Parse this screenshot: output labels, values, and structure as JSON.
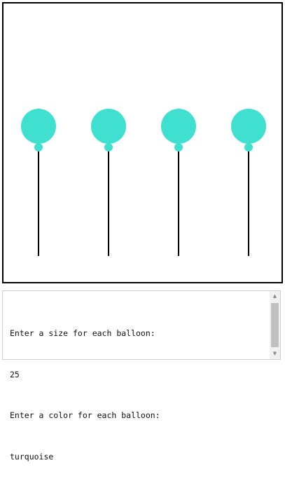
{
  "canvas": {
    "balloon_count": 4,
    "balloon_color": "#40e0d0",
    "string_color": "#000000"
  },
  "console": {
    "lines": [
      "Enter a size for each balloon:",
      "25",
      "Enter a color for each balloon:",
      "turquoise"
    ]
  },
  "scrollbar": {
    "up_icon": "triangle-up-icon",
    "down_icon": "triangle-down-icon"
  }
}
